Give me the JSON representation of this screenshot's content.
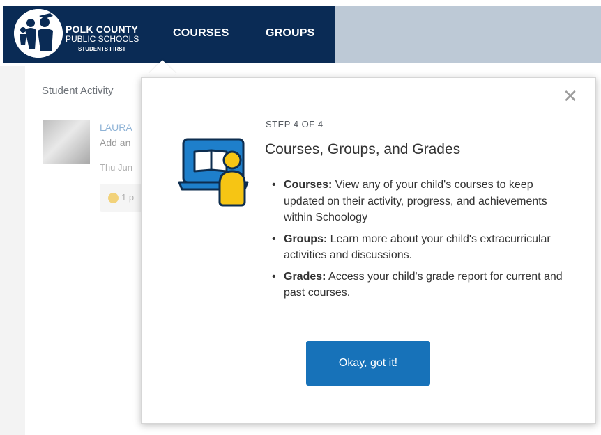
{
  "header": {
    "logo": {
      "line1": "POLK COUNTY",
      "line2": "PUBLIC SCHOOLS",
      "line3": "STUDENTS FIRST"
    },
    "nav": [
      {
        "label": "COURSES"
      },
      {
        "label": "GROUPS"
      }
    ],
    "colors": {
      "nav_bg": "#0a2b55",
      "right_bg": "#bdc9d6"
    }
  },
  "background_page": {
    "section_title": "Student Activity",
    "post": {
      "name": "LAURA",
      "text": "Add an",
      "date": "Thu Jun",
      "like_count": "1 p"
    }
  },
  "tour": {
    "step": "STEP 4 OF 4",
    "title": "Courses, Groups, and Grades",
    "close_icon": "close-icon",
    "items": [
      {
        "term": "Courses:",
        "text": " View any of your child's courses to keep updated on their activity, progress, and achievements within Schoology"
      },
      {
        "term": "Groups:",
        "text": " Learn more about your child's extracurricular activities and discussions."
      },
      {
        "term": "Grades:",
        "text": " Access your child's grade report for current and past courses."
      }
    ],
    "button_label": "Okay, got it!",
    "colors": {
      "button": "#1772b9",
      "illustration_blue": "#1e7fcb",
      "illustration_yellow": "#f6c514"
    }
  }
}
